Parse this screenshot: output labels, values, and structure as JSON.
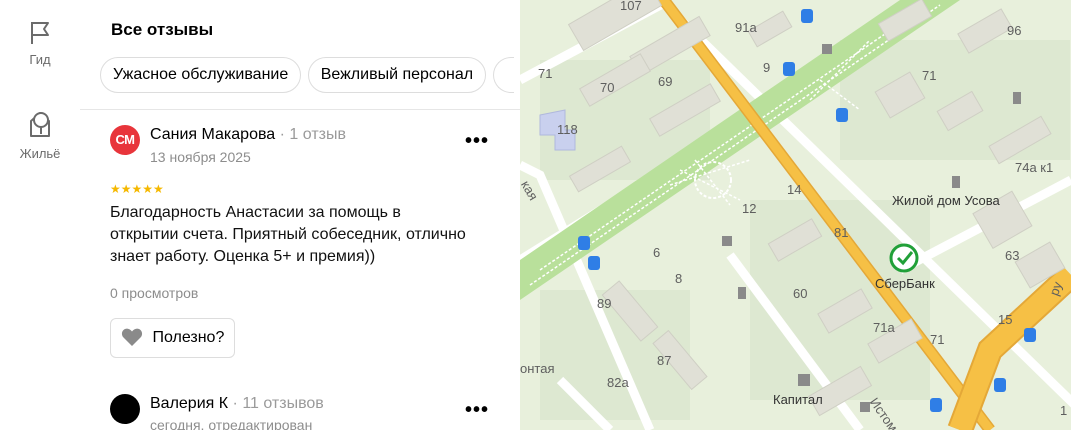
{
  "rail": {
    "items": [
      {
        "label": "Гид"
      },
      {
        "label": "Жильё"
      }
    ]
  },
  "reviews_panel": {
    "title": "Все отзывы",
    "chips": [
      "Ужасное обслуживание",
      "Вежливый персонал"
    ],
    "reviews": [
      {
        "avatar_initials": "СМ",
        "avatar_color": "#e8353b",
        "author": "Сания Макарова",
        "author_reviews": "1 отзыв",
        "date": "13 ноября 2025",
        "stars": 5,
        "stars_text": "★★★★★",
        "text": "Благодарность Анастасии за помощь в открытии счета. Приятный собеседник, отлично знает работу. Оценка 5+ и премия))",
        "views": "0 просмотров",
        "useful_label": "Полезно?",
        "more": "•••"
      },
      {
        "avatar_initials": "",
        "avatar_color": "#000000",
        "author": "Валерия К",
        "author_reviews": "11 отзывов",
        "date": "сегодня, отредактирован",
        "more": "•••"
      }
    ]
  },
  "map": {
    "labels": {
      "l107": "107",
      "l91a": "91а",
      "l96": "96",
      "l71": "71",
      "l70": "70",
      "l69": "69",
      "l9": "9",
      "l71b": "71",
      "l118": "118",
      "l74a": "74а к1",
      "l14": "14",
      "l12": "12",
      "l81": "81",
      "l63": "63",
      "l8": "8",
      "l6": "6",
      "l60": "60",
      "l89": "89",
      "l71a": "71а",
      "l71c": "71",
      "l15": "15",
      "l87": "87",
      "l82a": "82а",
      "l1": "1",
      "usova": "Жилой дом Усова",
      "sber": "СберБанк",
      "capital": "Капитал",
      "street_kaya": "кая",
      "street_ontaya": "онтая",
      "street_istom": "Истом",
      "street_ru": "ру"
    },
    "colors": {
      "background": "#e8f0dc",
      "park": "#b9e09b",
      "main_road": "#f6c045",
      "building": "#e0e0d6",
      "sber_green": "#21a038"
    }
  }
}
